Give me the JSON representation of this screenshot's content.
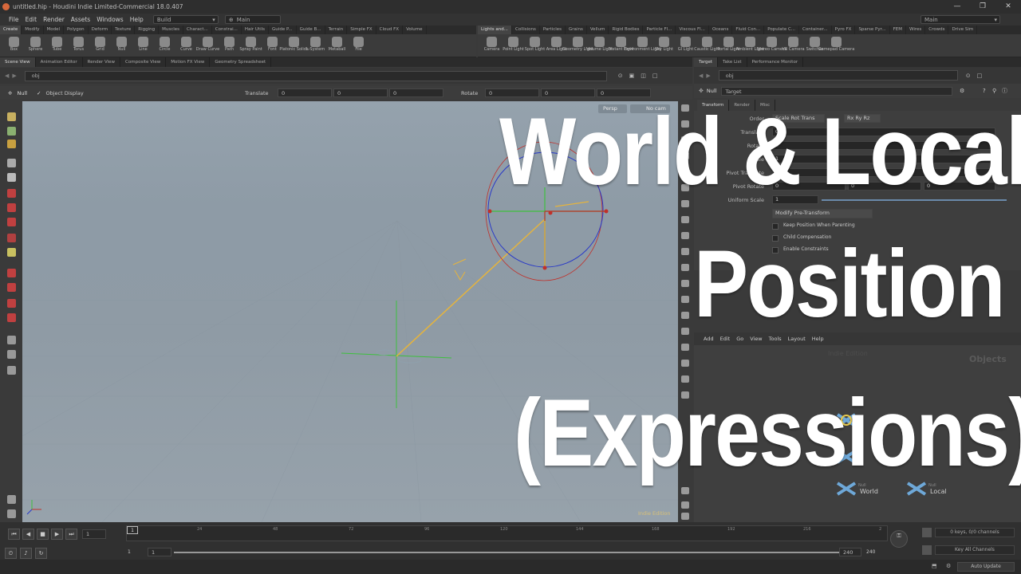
{
  "titlebar": {
    "title": "untitled.hip - Houdini Indie Limited-Commercial 18.0.407",
    "controls": [
      "—",
      "❐",
      "✕"
    ]
  },
  "menubar": {
    "items": [
      "File",
      "Edit",
      "Render",
      "Assets",
      "Windows",
      "Help"
    ],
    "desktop": "Build",
    "context": "Main",
    "right_desktop": "Main"
  },
  "shelf_left": {
    "tabs": [
      "Create",
      "Modify",
      "Model",
      "Polygon",
      "Deform",
      "Texture",
      "Rigging",
      "Muscles",
      "Charact...",
      "Constrai...",
      "Hair Utils",
      "Guide P...",
      "Guide B...",
      "Terrain",
      "Simple FX",
      "Cloud FX",
      "Volume"
    ],
    "tools": [
      "Box",
      "Sphere",
      "Tube",
      "Torus",
      "Grid",
      "Null",
      "Line",
      "Circle",
      "Curve",
      "Draw Curve",
      "Path",
      "Spray Paint",
      "Font",
      "Platonic Solids",
      "L-System",
      "Metaball",
      "File"
    ]
  },
  "shelf_right": {
    "tabs": [
      "Lights and...",
      "Collisions",
      "Particles",
      "Grains",
      "Vellum",
      "Rigid Bodies",
      "Particle Fl...",
      "Viscous Fl...",
      "Oceans",
      "Fluid Con...",
      "Populate C...",
      "Container...",
      "Pyro FX",
      "Sparse Pyr...",
      "FEM",
      "Wires",
      "Crowds",
      "Drive Sim"
    ],
    "tools": [
      "Camera",
      "Point Light",
      "Spot Light",
      "Area Light",
      "Geometry Light",
      "Volume Light",
      "Distant Light",
      "Environment Light",
      "Sky Light",
      "GI Light",
      "Caustic Light",
      "Portal Light",
      "Ambient Light",
      "Stereo Camera",
      "VR Camera",
      "Switcher",
      "Gamepad Camera"
    ]
  },
  "left_pane": {
    "tabs": [
      "Scene View",
      "Animation Editor",
      "Render View",
      "Composite View",
      "Motion FX View",
      "Geometry Spreadsheet"
    ],
    "path": "obj",
    "op_type": "Null",
    "object_display": "Object Display",
    "translate_label": "Translate",
    "translate": [
      "0",
      "0",
      "0"
    ],
    "rotate_label": "Rotate",
    "rotate": [
      "0",
      "0",
      "0"
    ],
    "persp": "Persp",
    "cam": "No cam",
    "watermark": "Indie Edition"
  },
  "right_pane": {
    "tabs": [
      "Target",
      "Take List",
      "Performance Monitor"
    ],
    "path": "obj",
    "node_type": "Null",
    "node_name": "Target",
    "param_tabs": [
      "Transform",
      "Render",
      "Misc"
    ],
    "params": [
      {
        "label": "Order",
        "values": [
          "Scale Rot Trans",
          "Rx Ry Rz"
        ]
      },
      {
        "label": "Translate",
        "values": [
          "0"
        ]
      },
      {
        "label": "Rotate",
        "values": [
          "0"
        ]
      },
      {
        "label": "Scale",
        "values": [
          "1"
        ]
      },
      {
        "label": "Pivot Translate",
        "values": [
          "0"
        ]
      },
      {
        "label": "Pivot Rotate",
        "values": [
          "0",
          "0",
          "0"
        ]
      },
      {
        "label": "Uniform Scale",
        "values": [
          "1"
        ]
      }
    ],
    "modify_pre": "Modify Pre-Transform",
    "checkboxes": [
      "Keep Position When Parenting",
      "Child Compensation",
      "Enable Constraints"
    ],
    "net_menu": [
      "Add",
      "Edit",
      "Go",
      "View",
      "Tools",
      "Layout",
      "Help"
    ],
    "net_watermark": "Indie Edition",
    "net_context": "Objects",
    "nodes": [
      {
        "type": "Null",
        "name": "World"
      },
      {
        "type": "Null",
        "name": "Local"
      }
    ]
  },
  "timeline": {
    "frame": "1",
    "ticks": [
      "24",
      "48",
      "72",
      "96",
      "120",
      "144",
      "168",
      "192",
      "216",
      "2"
    ],
    "start": "1",
    "start2": "1",
    "end": "240",
    "end2": "240",
    "keys_info": "0 keys, 0/0 channels",
    "key_all": "Key All Channels",
    "auto_update": "Auto Update"
  },
  "overlay": {
    "line1": "World & Local",
    "line2": "Position",
    "line3": "(Expressions)"
  },
  "colors": {
    "accent": "#d8683c",
    "viewport_top": "#95a2ad",
    "handle_yellow": "#e6b43c",
    "handle_red": "#c0302a",
    "handle_blue": "#2838c8",
    "handle_green": "#3ec03e"
  }
}
